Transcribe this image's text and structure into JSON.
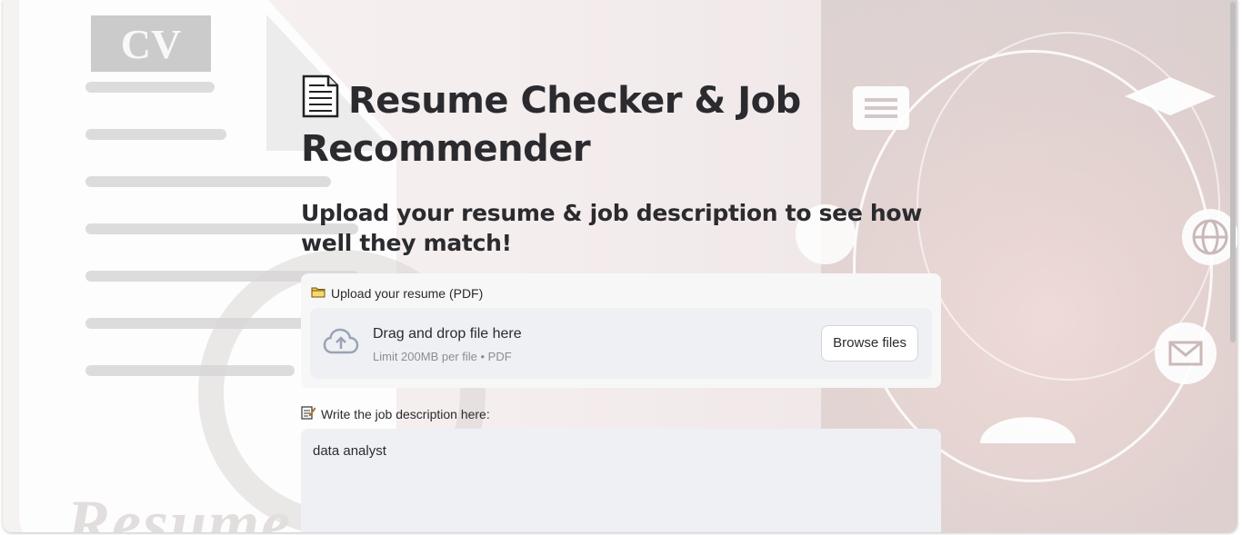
{
  "header": {
    "title": "Resume Checker & Job Recommender",
    "title_icon": "page-document-icon",
    "subtitle": "Upload your resume & job description to see how well they match!"
  },
  "resume_uploader": {
    "label": "Upload your resume (PDF)",
    "label_icon": "folder-icon",
    "drop_title": "Drag and drop file here",
    "drop_subtitle": "Limit 200MB per file • PDF",
    "browse_label": "Browse files",
    "upload_icon": "cloud-upload-icon"
  },
  "job_description": {
    "label": "Write the job description here:",
    "label_icon": "memo-icon",
    "value": "data analyst"
  },
  "background": {
    "cv_text": "CV",
    "resume_text": "Resume"
  },
  "colors": {
    "text": "#2b2b2f",
    "muted": "#8a8d93",
    "dropzone": "#eef0f4",
    "card": "#f7f7f8"
  }
}
